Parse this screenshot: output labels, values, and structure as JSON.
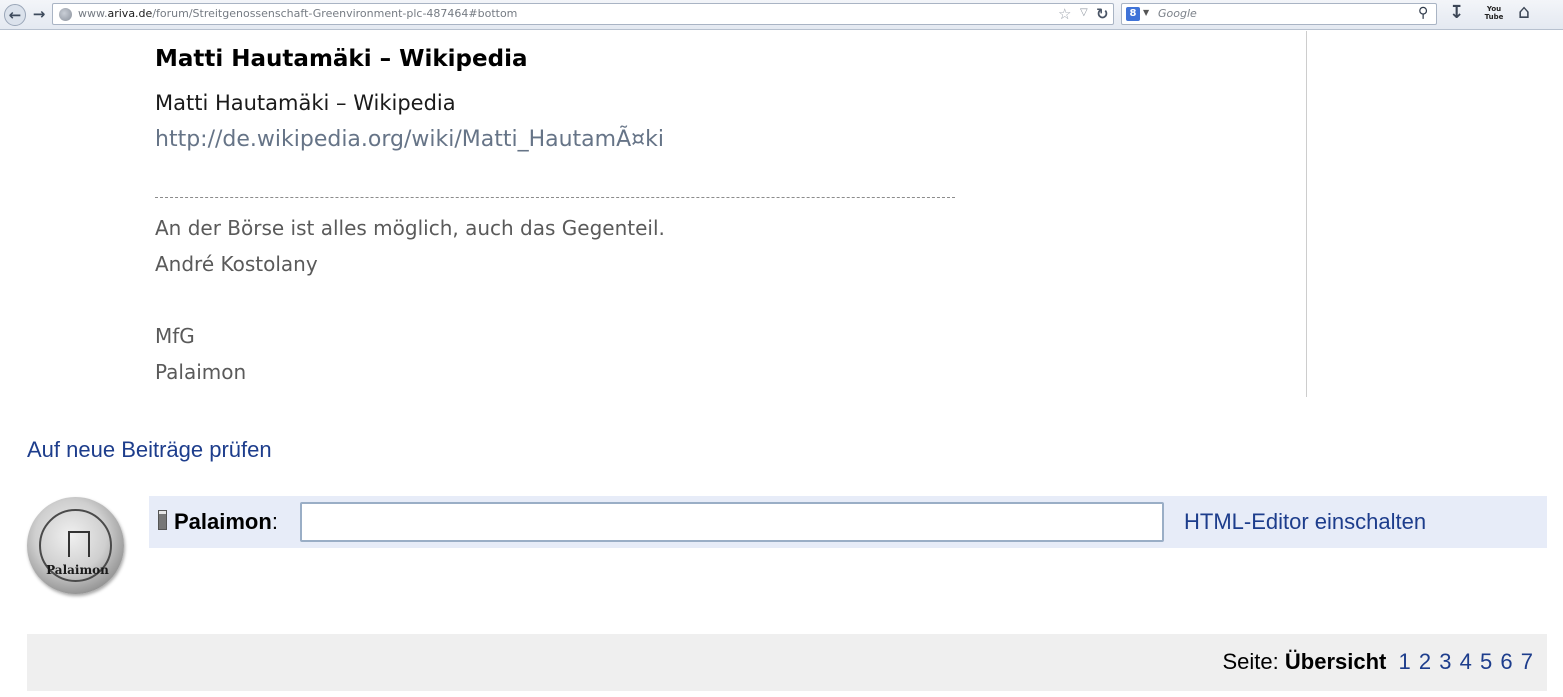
{
  "browser": {
    "url_prefix": "www.",
    "url_domain": "ariva.de",
    "url_path": "/forum/Streitgenossenschaft-Greenvironment-plc-487464#bottom",
    "search_engine_letter": "8",
    "search_placeholder": "Google",
    "youtube_label_top": "You",
    "youtube_label_bottom": "Tube"
  },
  "post": {
    "title": "Matti Hautamäki – Wikipedia",
    "link_title": "Matti Hautamäki – Wikipedia",
    "link_url": "http://de.wikipedia.org/wiki/Matti_HautamÃ¤ki",
    "signature": {
      "quote": "An der Börse ist alles möglich, auch das Gegenteil.",
      "quote_author": "André Kostolany",
      "greeting": "MfG",
      "name": "Palaimon"
    }
  },
  "check_new_posts": "Auf neue Beiträge prüfen",
  "reply": {
    "avatar_text": "Palaimon",
    "username": "Palaimon",
    "separator": ":",
    "input_value": "",
    "html_editor_link": "HTML-Editor einschalten"
  },
  "pagination": {
    "label": "Seite:",
    "overview": "Übersicht",
    "pages": [
      "1",
      "2",
      "3",
      "4",
      "5",
      "6",
      "7"
    ]
  }
}
